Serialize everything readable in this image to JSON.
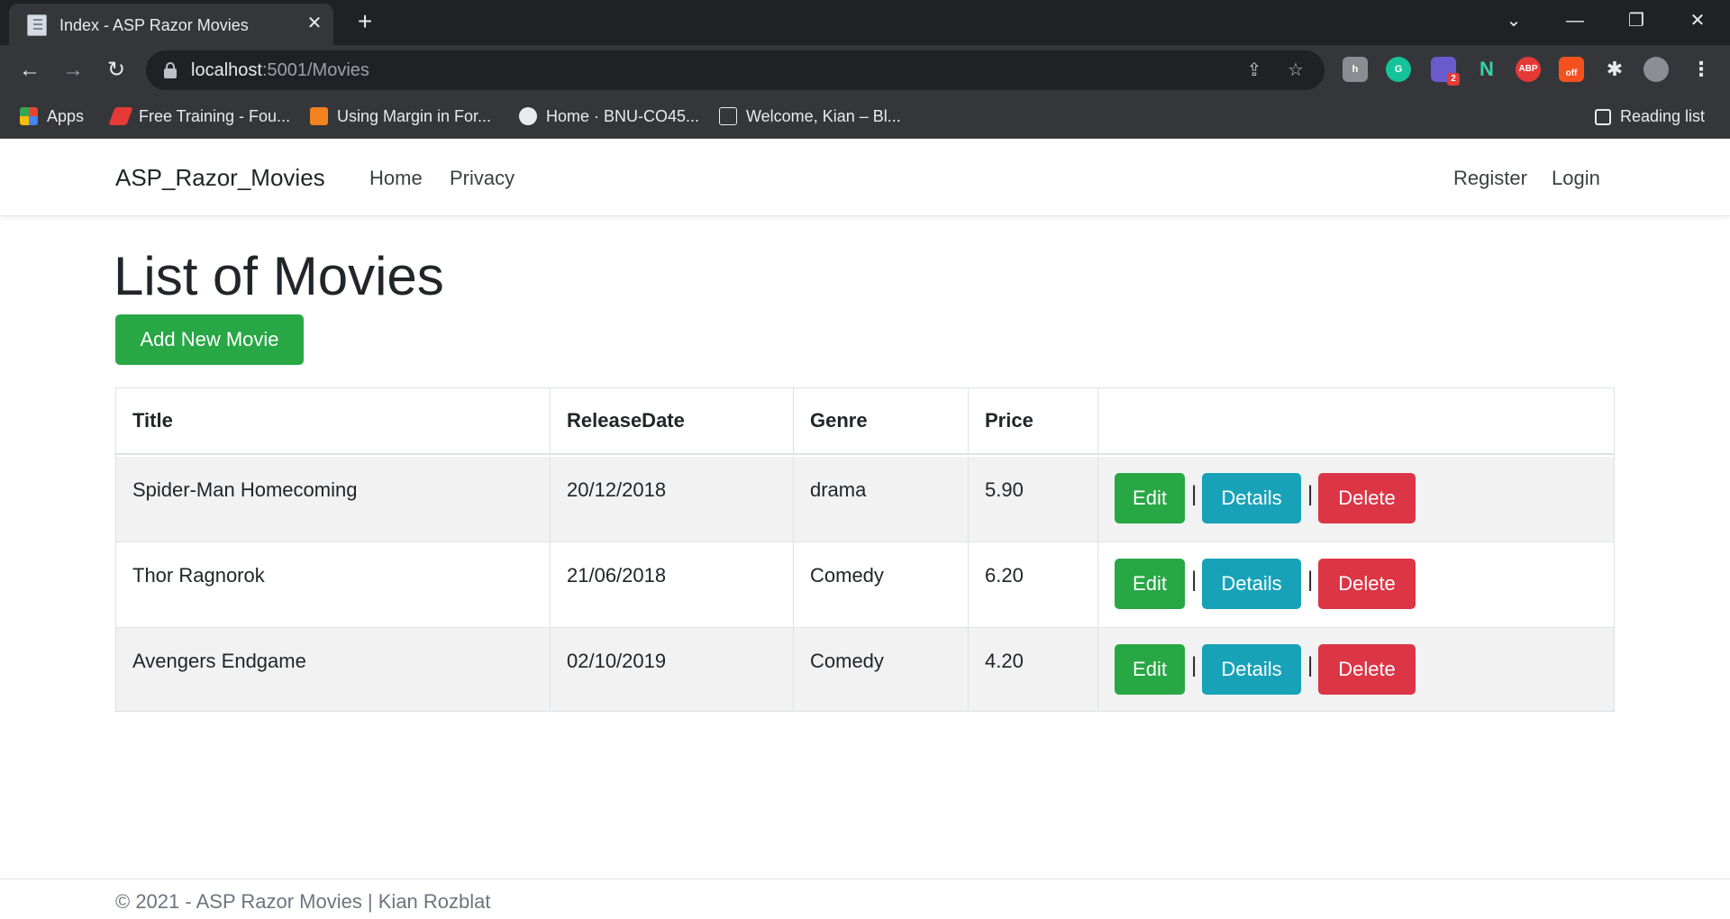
{
  "browser": {
    "tab_title": "Index - ASP Razor Movies",
    "url_host": "localhost",
    "url_path": ":5001/Movies",
    "bookmarks": [
      {
        "label": "Apps",
        "icon": "apps-grid-icon"
      },
      {
        "label": "Free Training - Fou...",
        "icon": "red-feather-icon"
      },
      {
        "label": "Using Margin in For...",
        "icon": "dfx-icon"
      },
      {
        "label": "Home · BNU-CO45...",
        "icon": "github-icon"
      },
      {
        "label": "Welcome, Kian – Bl...",
        "icon": "blackboard-icon"
      }
    ],
    "reading_list": "Reading list",
    "extension_badges": {
      "grammarly_count": "2",
      "coupon_status": "off",
      "abp": "ABP"
    }
  },
  "site": {
    "brand": "ASP_Razor_Movies",
    "nav": {
      "home": "Home",
      "privacy": "Privacy",
      "register": "Register",
      "login": "Login"
    }
  },
  "main": {
    "title": "List of Movies",
    "add_button": "Add New Movie",
    "table": {
      "headers": [
        "Title",
        "ReleaseDate",
        "Genre",
        "Price",
        ""
      ],
      "rows": [
        {
          "title": "Spider-Man Homecoming",
          "release_date": "20/12/2018",
          "genre": "drama",
          "price": "5.90"
        },
        {
          "title": "Thor Ragnorok",
          "release_date": "21/06/2018",
          "genre": "Comedy",
          "price": "6.20"
        },
        {
          "title": "Avengers Endgame",
          "release_date": "02/10/2019",
          "genre": "Comedy",
          "price": "4.20"
        }
      ],
      "actions": {
        "edit": "Edit",
        "details": "Details",
        "delete": "Delete",
        "separator": "|"
      }
    }
  },
  "footer": {
    "text": "© 2021 - ASP Razor Movies | Kian Rozblat"
  },
  "colors": {
    "success": "#28a745",
    "info": "#17a2b8",
    "danger": "#dc3545",
    "stripe": "#f2f2f2"
  }
}
